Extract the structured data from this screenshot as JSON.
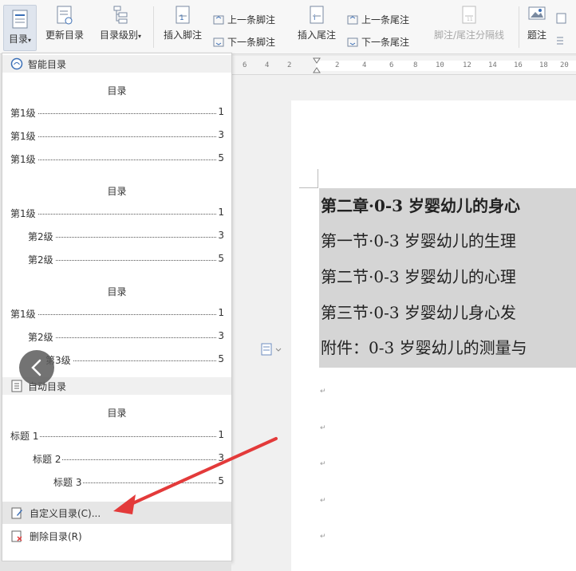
{
  "ribbon": {
    "toc_label": "目录",
    "update_toc": "更新目录",
    "toc_level": "目录级别",
    "insert_footnote": "插入脚注",
    "prev_footnote": "上一条脚注",
    "next_footnote": "下一条脚注",
    "insert_endnote": "插入尾注",
    "prev_endnote": "上一条尾注",
    "next_endnote": "下一条尾注",
    "separator": "脚注/尾注分隔线",
    "caption": "题注"
  },
  "ruler": {
    "ticks": [
      "6",
      "4",
      "2",
      "2",
      "4",
      "6",
      "8",
      "10",
      "12",
      "14",
      "16",
      "18",
      "20"
    ]
  },
  "dropdown": {
    "smart_toc": "智能目录",
    "auto_toc": "自动目录",
    "style1": {
      "title": "目录",
      "rows": [
        {
          "label": "第1级",
          "page": "1"
        },
        {
          "label": "第1级",
          "page": "3"
        },
        {
          "label": "第1级",
          "page": "5"
        }
      ]
    },
    "style2": {
      "title": "目录",
      "rows": [
        {
          "label": "第1级",
          "page": "1"
        },
        {
          "label": "第2级",
          "page": "3"
        },
        {
          "label": "第2级",
          "page": "5"
        }
      ]
    },
    "style3": {
      "title": "目录",
      "rows": [
        {
          "label": "第1级",
          "page": "1"
        },
        {
          "label": "第2级",
          "page": "3"
        },
        {
          "label": "第3级",
          "page": "5"
        }
      ]
    },
    "style4": {
      "title": "目录",
      "rows": [
        {
          "label": "标题 1",
          "page": "1"
        },
        {
          "label": "标题 2",
          "page": "3"
        },
        {
          "label": "标题 3",
          "page": "5"
        }
      ]
    },
    "custom_toc": "自定义目录(C)...",
    "delete_toc": "删除目录(R)"
  },
  "document": {
    "lines": [
      "第二章·0-3 岁婴幼儿的身心",
      "第一节·0-3 岁婴幼儿的生理",
      "第二节·0-3 岁婴幼儿的心理",
      "第三节·0-3 岁婴幼儿身心发",
      "附件：0-3 岁婴幼儿的测量与"
    ],
    "para_mark": "↵"
  },
  "colors": {
    "accent": "#e33a3a",
    "selection_gray": "#d5d5d5",
    "ribbon_icon_blue": "#3b6fb6"
  }
}
